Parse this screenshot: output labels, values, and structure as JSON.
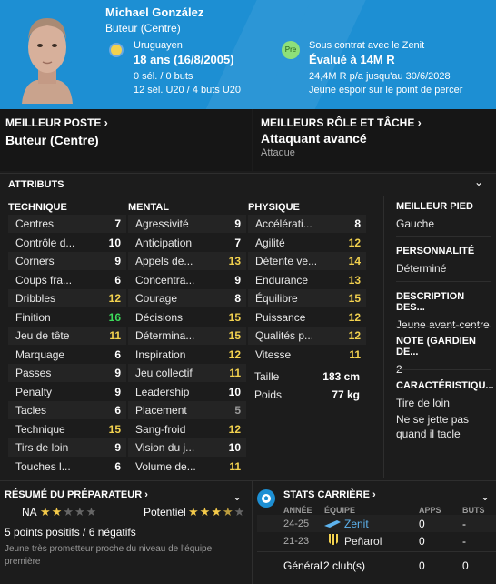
{
  "header": {
    "name": "Michael González",
    "position": "Buteur (Centre)",
    "nationality": "Uruguayen",
    "age": "18 ans (16/8/2005)",
    "caps": "0 sél. / 0 buts",
    "u20": "12 sél. U20 / 4 buts U20",
    "pre_badge": "Pre",
    "contract": "Sous contrat avec le Zenit",
    "value": "Évalué à 14M R",
    "wage": "24,4M R p/a jusqu'au 30/6/2028",
    "description": "Jeune espoir sur le point de percer",
    "brand_color": "#1d8fd3"
  },
  "best_position": {
    "label": "MEILLEUR POSTE",
    "value": "Buteur (Centre)"
  },
  "best_role": {
    "label": "MEILLEURS RÔLE ET TÂCHE",
    "value": "Attaquant avancé",
    "sub": "Attaque"
  },
  "attributes": {
    "title": "ATTRIBUTS",
    "technique": {
      "title": "TECHNIQUE",
      "items": [
        {
          "name": "Centres",
          "value": "7"
        },
        {
          "name": "Contrôle d...",
          "value": "10"
        },
        {
          "name": "Corners",
          "value": "9"
        },
        {
          "name": "Coups fra...",
          "value": "6"
        },
        {
          "name": "Dribbles",
          "value": "12"
        },
        {
          "name": "Finition",
          "value": "16"
        },
        {
          "name": "Jeu de tête",
          "value": "11"
        },
        {
          "name": "Marquage",
          "value": "6"
        },
        {
          "name": "Passes",
          "value": "9"
        },
        {
          "name": "Penalty",
          "value": "9"
        },
        {
          "name": "Tacles",
          "value": "6"
        },
        {
          "name": "Technique",
          "value": "15"
        },
        {
          "name": "Tirs de loin",
          "value": "9"
        },
        {
          "name": "Touches l...",
          "value": "6"
        }
      ]
    },
    "mental": {
      "title": "MENTAL",
      "items": [
        {
          "name": "Agressivité",
          "value": "9"
        },
        {
          "name": "Anticipation",
          "value": "7"
        },
        {
          "name": "Appels de...",
          "value": "13"
        },
        {
          "name": "Concentra...",
          "value": "9"
        },
        {
          "name": "Courage",
          "value": "8"
        },
        {
          "name": "Décisions",
          "value": "15"
        },
        {
          "name": "Détermina...",
          "value": "15"
        },
        {
          "name": "Inspiration",
          "value": "12"
        },
        {
          "name": "Jeu collectif",
          "value": "11"
        },
        {
          "name": "Leadership",
          "value": "10"
        },
        {
          "name": "Placement",
          "value": "5"
        },
        {
          "name": "Sang-froid",
          "value": "12"
        },
        {
          "name": "Vision du j...",
          "value": "10"
        },
        {
          "name": "Volume de...",
          "value": "11"
        }
      ]
    },
    "physique": {
      "title": "PHYSIQUE",
      "items": [
        {
          "name": "Accélérati...",
          "value": "8"
        },
        {
          "name": "Agilité",
          "value": "12"
        },
        {
          "name": "Détente ve...",
          "value": "14"
        },
        {
          "name": "Endurance",
          "value": "13"
        },
        {
          "name": "Équilibre",
          "value": "15"
        },
        {
          "name": "Puissance",
          "value": "12"
        },
        {
          "name": "Qualités p...",
          "value": "12"
        },
        {
          "name": "Vitesse",
          "value": "11"
        }
      ]
    },
    "taille": {
      "name": "Taille",
      "value": "183 cm"
    },
    "poids": {
      "name": "Poids",
      "value": "77 kg"
    }
  },
  "side": {
    "pied": {
      "label": "MEILLEUR PIED",
      "value": "Gauche"
    },
    "perso": {
      "label": "PERSONNALITÉ",
      "value": "Déterminé"
    },
    "description": {
      "label": "DESCRIPTION DES...",
      "value": "Jeune avant-centre"
    },
    "note": {
      "label": "NOTE (GARDIEN DE...",
      "value": "2"
    },
    "carac": {
      "label": "CARACTÉRISTIQU...",
      "line1": "Tire de loin",
      "line2": "Ne se jette pas",
      "line3": "quand il tacle"
    }
  },
  "coach": {
    "title": "RÉSUMÉ DU PRÉPARATEUR",
    "na_label": "NA",
    "na_stars": 2,
    "pot_label": "Potentiel",
    "pot_stars": 3.5,
    "summary": "5 points positifs / 6 négatifs",
    "note": "Jeune très prometteur proche du niveau de l'équipe première"
  },
  "career": {
    "title": "STATS CARRIÈRE",
    "headers": {
      "year": "ANNÉE",
      "team": "ÉQUIPE",
      "apps": "APPS",
      "goals": "BUTS"
    },
    "rows": [
      {
        "year": "24-25",
        "team": "Zenit",
        "apps": "0",
        "goals": "-"
      },
      {
        "year": "21-23",
        "team": "Peñarol",
        "apps": "0",
        "goals": "-"
      }
    ],
    "total": {
      "label": "Général",
      "clubs": "2 club(s)",
      "apps": "0",
      "goals": "0"
    }
  },
  "colors": {
    "green": "#3ddc5b",
    "yellow": "#f3d24f",
    "white": "#ffffff",
    "grey": "#999999"
  }
}
